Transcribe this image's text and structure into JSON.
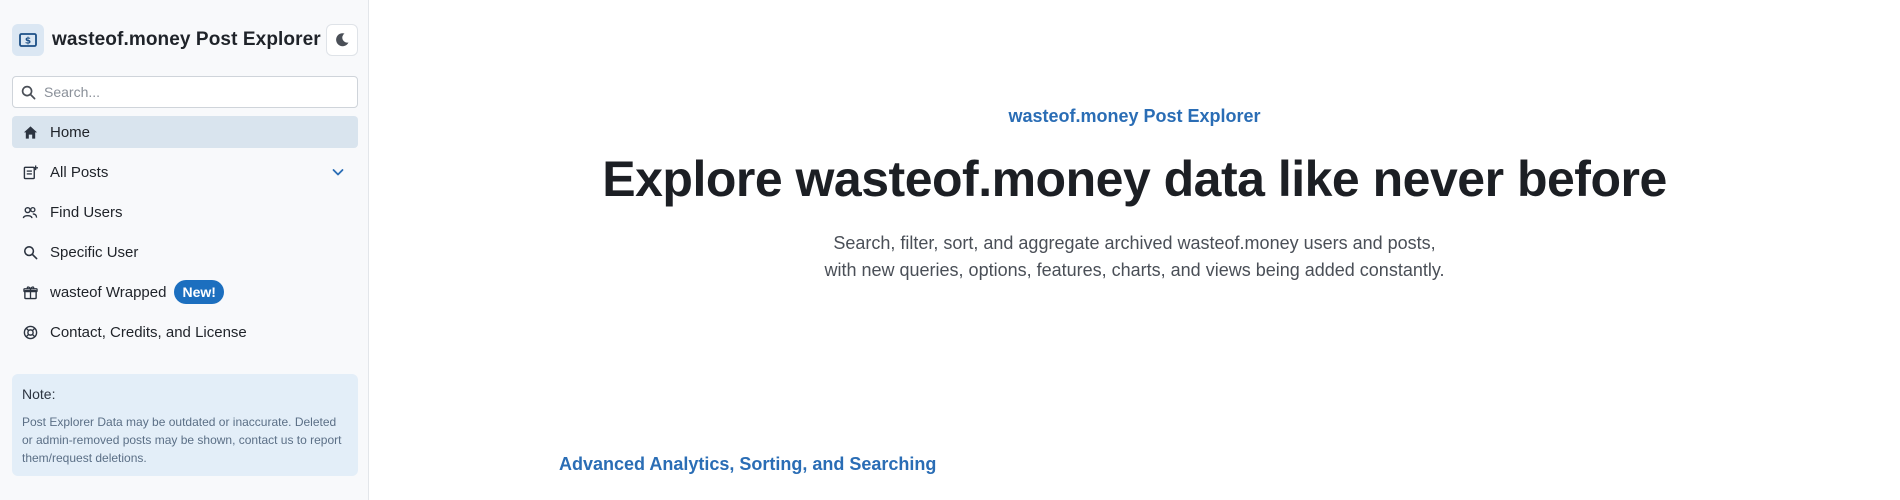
{
  "sidebar": {
    "brand": {
      "title": "wasteof.money Post Explorer",
      "logo_icon": "dollar-bill-icon"
    },
    "theme_toggle": {
      "icon": "moon-icon"
    },
    "search": {
      "placeholder": "Search...",
      "value": ""
    },
    "nav": [
      {
        "label": "Home",
        "icon": "home-icon",
        "active": true
      },
      {
        "label": "All Posts",
        "icon": "posts-icon",
        "expandable": true
      },
      {
        "label": "Find Users",
        "icon": "users-icon"
      },
      {
        "label": "Specific User",
        "icon": "search-icon"
      },
      {
        "label": "wasteof Wrapped",
        "icon": "gift-icon",
        "badge": "New!"
      },
      {
        "label": "Contact, Credits, and License",
        "icon": "lifebuoy-icon"
      }
    ],
    "note": {
      "title": "Note:",
      "text": "Post Explorer Data may be outdated or inaccurate. Deleted or admin-removed posts may be shown, contact us to report them/request deletions."
    }
  },
  "main": {
    "eyebrow": "wasteof.money Post Explorer",
    "title": "Explore wasteof.money data like never before",
    "subtitle_line1": "Search, filter, sort, and aggregate archived wasteof.money users and posts,",
    "subtitle_line2": "with new queries, options, features, charts, and views being added constantly.",
    "section_heading": "Advanced Analytics, Sorting, and Searching"
  },
  "colors": {
    "accent": "#2a6db5",
    "badge": "#1c6fbf",
    "active_nav": "#d9e4ee",
    "note_bg": "#e3eef8"
  }
}
